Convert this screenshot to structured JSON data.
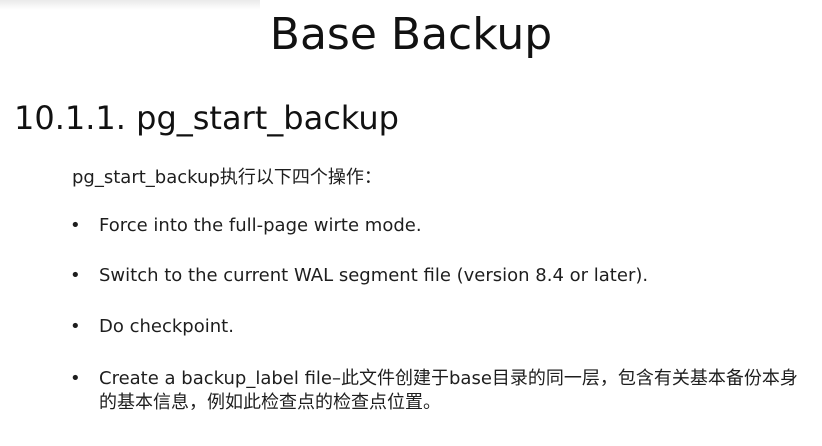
{
  "slide": {
    "title": "Base Backup",
    "section_heading": "10.1.1. pg_start_backup",
    "intro": "pg_start_backup执行以下四个操作：",
    "bullet_symbol": "•",
    "bullets": [
      {
        "text": "Force into the full-page wirte mode."
      },
      {
        "text": "Switch to the current WAL segment file (version 8.4 or later)."
      },
      {
        "text": "Do checkpoint."
      },
      {
        "text": "Create a backup_label file–此文件创建于base目录的同一层，包含有关基本备份本身的基本信息，例如此检查点的检查点位置。"
      }
    ]
  }
}
